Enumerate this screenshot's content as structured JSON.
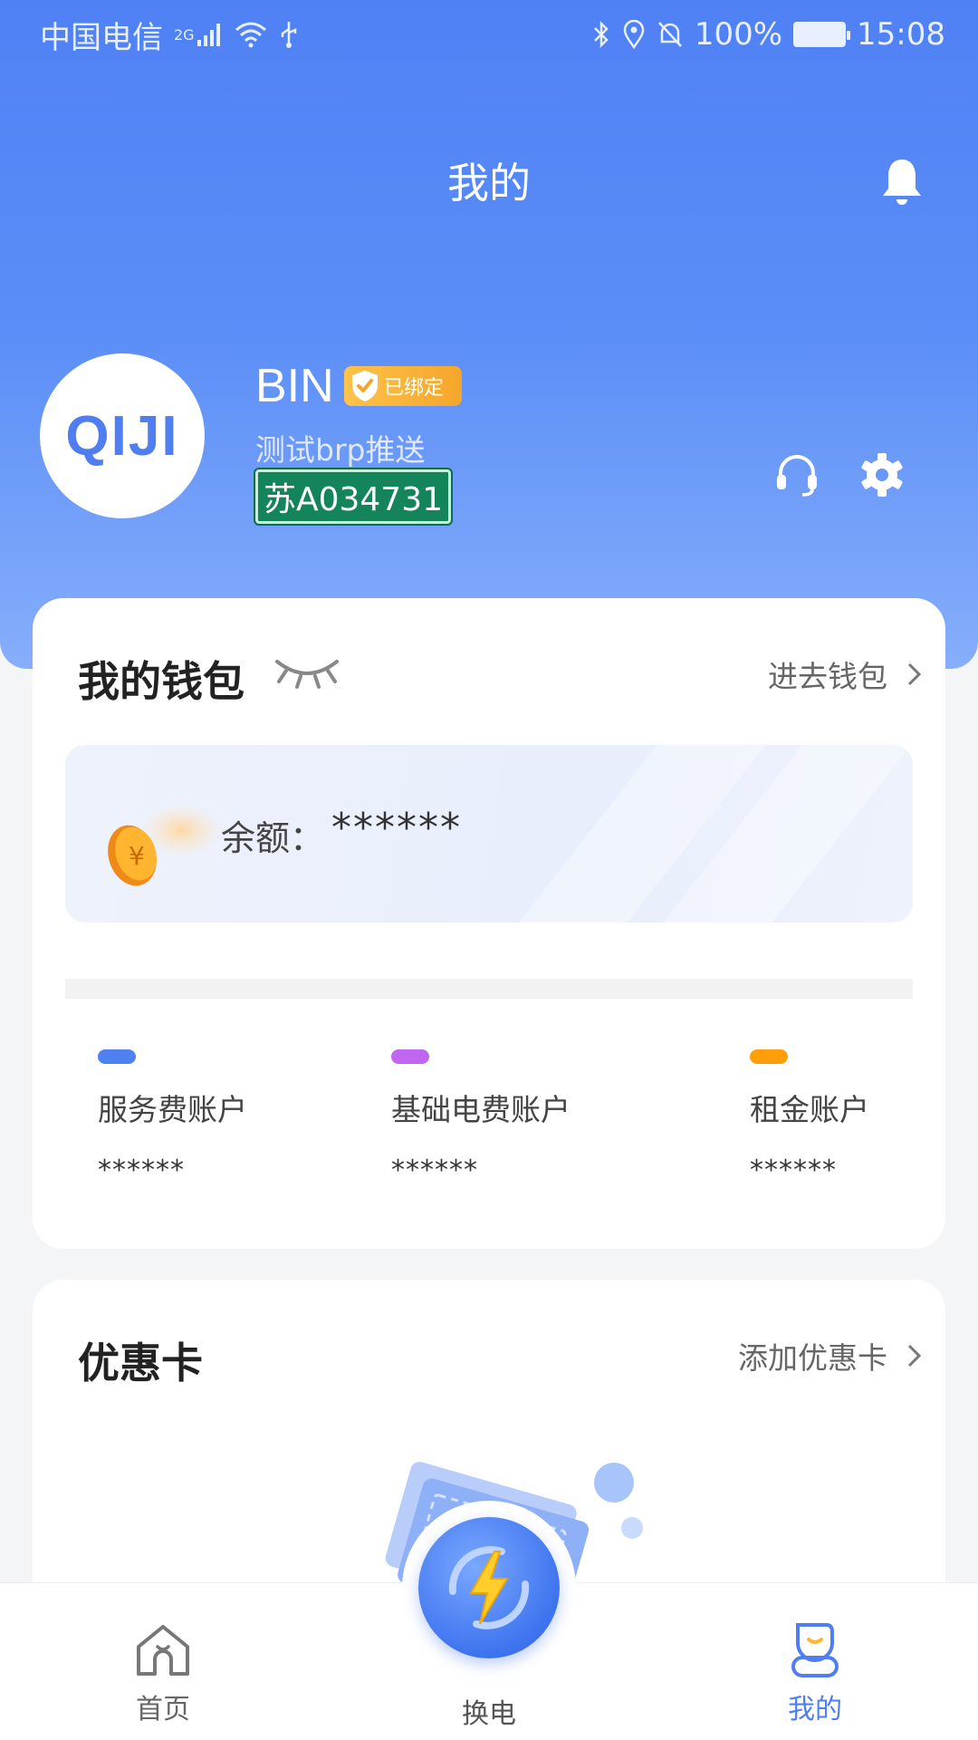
{
  "status_bar": {
    "carrier": "中国电信",
    "network": "2G",
    "battery": "100%",
    "time": "15:08"
  },
  "header": {
    "title": "我的"
  },
  "profile": {
    "avatar_logo": "QIJI",
    "name": "BIN",
    "bound_badge": "已绑定",
    "subtitle": "测试brp推送",
    "plate": "苏A034731"
  },
  "wallet": {
    "title": "我的钱包",
    "link": "进去钱包",
    "balance_label": "余额：",
    "balance_value": "******",
    "accounts": [
      {
        "name": "服务费账户",
        "value": "******",
        "color": "#4f80f2"
      },
      {
        "name": "基础电费账户",
        "value": "******",
        "color": "#c066f0"
      },
      {
        "name": "租金账户",
        "value": "******",
        "color": "#ff9d0a"
      }
    ]
  },
  "coupon": {
    "title": "优惠卡",
    "link": "添加优惠卡"
  },
  "tabbar": {
    "home": "首页",
    "swap": "换电",
    "mine": "我的"
  },
  "colors": {
    "accent": "#4f7df2",
    "header_top": "#4f81f5",
    "header_bottom": "#86aefb",
    "plate_green": "#14855a",
    "badge_gold": "#f4a62a"
  }
}
